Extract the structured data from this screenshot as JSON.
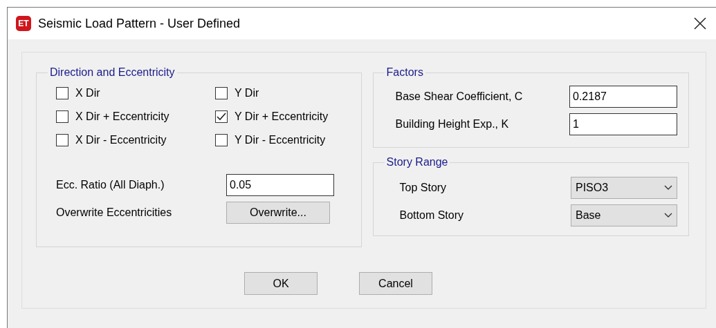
{
  "window": {
    "title": "Seismic Load Pattern - User Defined",
    "app_badge": "ET"
  },
  "direction": {
    "title": "Direction and Eccentricity",
    "options": [
      {
        "label": "X Dir",
        "checked": false
      },
      {
        "label": "Y Dir",
        "checked": false
      },
      {
        "label": "X Dir + Eccentricity",
        "checked": false
      },
      {
        "label": "Y Dir + Eccentricity",
        "checked": true
      },
      {
        "label": "X Dir - Eccentricity",
        "checked": false
      },
      {
        "label": "Y Dir - Eccentricity",
        "checked": false
      }
    ],
    "ecc_ratio": {
      "label": "Ecc. Ratio (All Diaph.)",
      "value": "0.05"
    },
    "overwrite": {
      "label": "Overwrite Eccentricities",
      "button": "Overwrite..."
    }
  },
  "factors": {
    "title": "Factors",
    "fields": [
      {
        "label": "Base Shear Coefficient, C",
        "value": "0.2187"
      },
      {
        "label": "Building Height Exp., K",
        "value": "1"
      }
    ]
  },
  "story_range": {
    "title": "Story Range",
    "fields": [
      {
        "label": "Top Story",
        "value": "PISO3"
      },
      {
        "label": "Bottom Story",
        "value": "Base"
      }
    ]
  },
  "buttons": [
    "OK",
    "Cancel"
  ]
}
